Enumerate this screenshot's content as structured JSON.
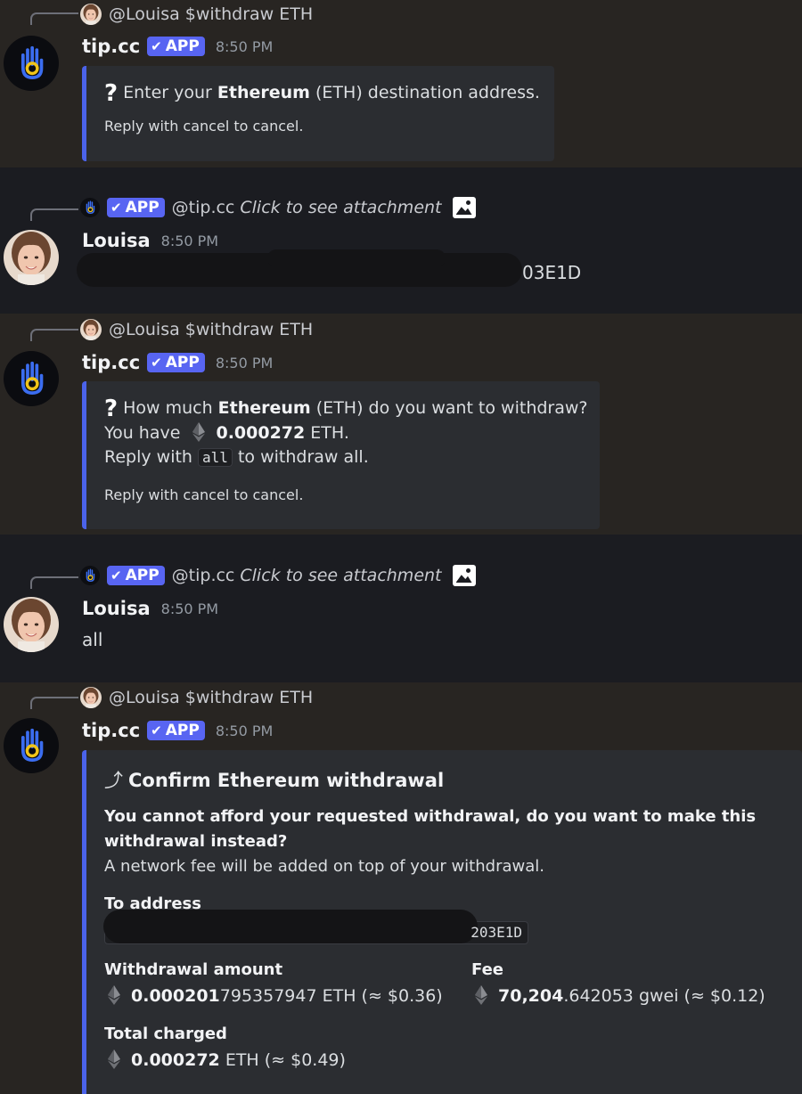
{
  "messages": [
    {
      "reply": {
        "user": "@Louisa",
        "text": "$withdraw ETH"
      },
      "author": "tip.cc",
      "badge": "APP",
      "time": "8:50 PM",
      "embed": {
        "question": "Enter your",
        "question_bold": "Ethereum",
        "question_rest": "(ETH) destination address.",
        "cancel": "Reply with cancel to cancel."
      }
    },
    {
      "reply": {
        "badge": "APP",
        "user": "@tip.cc",
        "text": "Click to see attachment"
      },
      "author": "Louisa",
      "time": "8:50 PM",
      "text": "03E1D"
    },
    {
      "reply": {
        "user": "@Louisa",
        "text": "$withdraw ETH"
      },
      "author": "tip.cc",
      "badge": "APP",
      "time": "8:50 PM",
      "embed": {
        "question": "How much",
        "question_bold": "Ethereum",
        "question_rest": "(ETH) do you want to withdraw?",
        "have_prefix": "You have",
        "have_amount": "0.000272",
        "have_suffix": "ETH.",
        "reply_prefix": "Reply with",
        "reply_code": "all",
        "reply_suffix": "to withdraw all.",
        "cancel": "Reply with cancel to cancel."
      }
    },
    {
      "reply": {
        "badge": "APP",
        "user": "@tip.cc",
        "text": "Click to see attachment"
      },
      "author": "Louisa",
      "time": "8:50 PM",
      "text": "all"
    },
    {
      "reply": {
        "user": "@Louisa",
        "text": "$withdraw ETH"
      },
      "author": "tip.cc",
      "badge": "APP",
      "time": "8:50 PM",
      "embed": {
        "title_icon": "⤴",
        "title": "Confirm Ethereum withdrawal",
        "warning_line1": "You cannot afford your requested withdrawal, do you want to make this",
        "warning_line2": "withdrawal instead?",
        "note": "A network fee will be added on top of your withdrawal.",
        "to_address_label": "To address",
        "to_address_value": "203E1D",
        "withdrawal_label": "Withdrawal amount",
        "withdrawal_bold": "0.000201",
        "withdrawal_rest": "795357947 ETH (≈ $0.36)",
        "fee_label": "Fee",
        "fee_bold": "70,204",
        "fee_rest": ".642053 gwei (≈ $0.12)",
        "total_label": "Total charged",
        "total_bold": "0.000272",
        "total_rest": "ETH (≈ $0.49)"
      }
    }
  ],
  "colors": {
    "accent": "#5865f2",
    "embed_border": "#4b63ea",
    "bot_logo_ring": "#f0c419",
    "bot_logo_hand": "#3b6df0"
  }
}
